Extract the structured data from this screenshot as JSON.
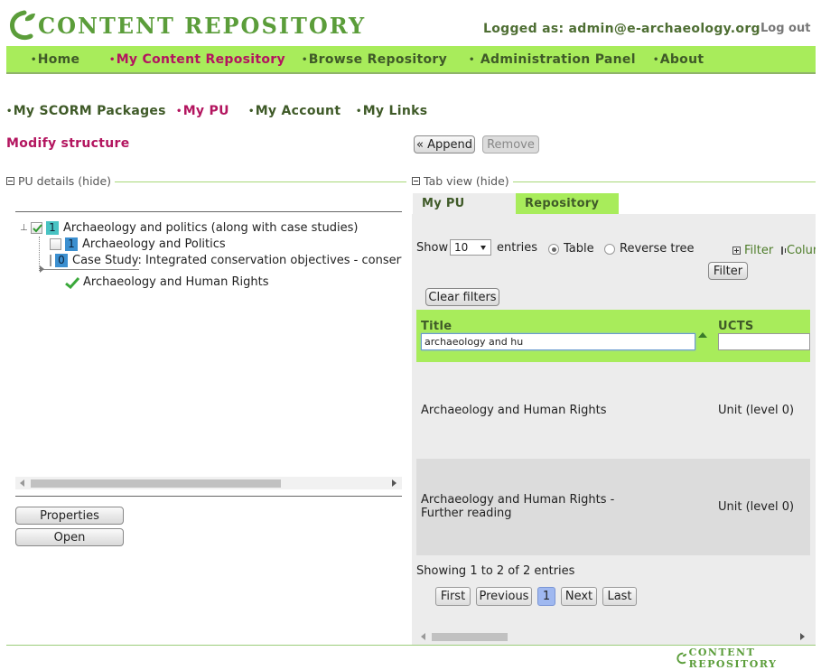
{
  "header": {
    "logo_text": "CONTENT REPOSITORY",
    "logged_as": "Logged as: admin@e-archaeology.org",
    "logout": "Log out"
  },
  "nav": {
    "items": [
      {
        "label": "Home"
      },
      {
        "label": "My Content Repository"
      },
      {
        "label": "Browse Repository"
      },
      {
        "label": "Administration Panel"
      },
      {
        "label": "About"
      }
    ]
  },
  "subnav": {
    "items": [
      {
        "label": "My SCORM Packages"
      },
      {
        "label": "My PU"
      },
      {
        "label": "My Account"
      },
      {
        "label": "My Links"
      }
    ]
  },
  "page": {
    "title": "Modify structure",
    "append_label": "« Append",
    "remove_label": "Remove"
  },
  "left_panel": {
    "section_title": "PU details (hide)",
    "tree": [
      {
        "badge": "1",
        "label": "Archaeology and politics (along with case studies)"
      },
      {
        "badge": "1",
        "label": "Archaeology and Politics"
      },
      {
        "badge": "0",
        "label": "Case Study: Integrated conservation objectives - conserva"
      },
      {
        "badge": "",
        "label": "Archaeology and Human Rights"
      }
    ],
    "properties_label": "Properties",
    "open_label": "Open"
  },
  "right_panel": {
    "section_title": "Tab view (hide)",
    "tabs": [
      {
        "label": "My PU"
      },
      {
        "label": "Repository"
      }
    ],
    "show_label": "Show",
    "entries_value": "10",
    "entries_label": "entries",
    "view_table": "Table",
    "view_reverse": "Reverse tree",
    "filter_toggle": "Filter",
    "columns_toggle": "Colur",
    "filter_button": "Filter",
    "clear_filters": "Clear filters",
    "columns": {
      "title": "Title",
      "ucts": "UCTS"
    },
    "title_filter_value": "archaeology and hu",
    "rows": [
      {
        "title": "Archaeology and Human Rights",
        "ucts": "Unit (level 0)"
      },
      {
        "title": "Archaeology and Human Rights - Further reading",
        "ucts": "Unit (level 0)"
      }
    ],
    "showing": "Showing 1 to 2 of 2 entries",
    "pagination": {
      "first": "First",
      "previous": "Previous",
      "page": "1",
      "next": "Next",
      "last": "Last"
    }
  },
  "footer": {
    "logo_text": "CONTENT REPOSITORY"
  },
  "colors": {
    "nav_green": "#a8ec5b",
    "accent_magenta": "#b3155f",
    "text_green": "#3f5a28"
  }
}
